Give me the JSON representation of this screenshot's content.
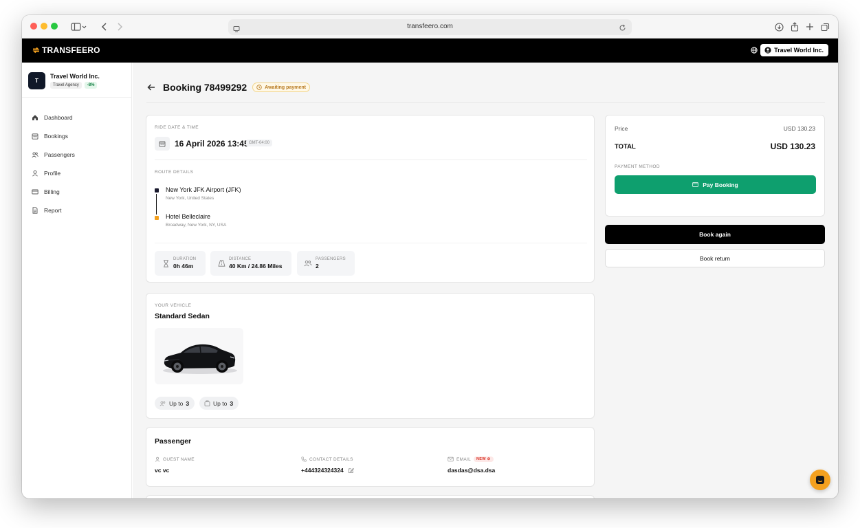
{
  "browser": {
    "url": "transfeero.com",
    "icons": [
      "close-dot",
      "minimize-dot",
      "maximize-dot",
      "sidebar-icon",
      "back-icon",
      "forward-icon",
      "page-icon",
      "reload-icon",
      "download-icon",
      "share-icon",
      "new-tab-icon",
      "tabs-icon"
    ],
    "colors": {
      "close": "#fe5f57",
      "minimize": "#febc2e",
      "maximize": "#28c840"
    }
  },
  "appbar": {
    "brand": "TRANSFEERO",
    "brand_accent": "#f4a11f",
    "language": "EN",
    "account": "Travel World Inc."
  },
  "sidebar": {
    "org_initial": "T",
    "org_name": "Travel World Inc.",
    "org_type": "Travel Agency",
    "discount": "-8%",
    "items": [
      {
        "label": "Dashboard",
        "icon": "home-icon"
      },
      {
        "label": "Bookings",
        "icon": "calendar-icon"
      },
      {
        "label": "Passengers",
        "icon": "users-icon"
      },
      {
        "label": "Profile",
        "icon": "user-icon"
      },
      {
        "label": "Billing",
        "icon": "card-icon"
      },
      {
        "label": "Report",
        "icon": "document-icon"
      }
    ]
  },
  "booking": {
    "title": "Booking 78499292",
    "status": "Awaiting payment",
    "status_color": "#b7791f"
  },
  "ride": {
    "date_label": "RIDE DATE & TIME",
    "datetime": "16 April 2026 13:45",
    "timezone": "GMT-04:00",
    "route_label": "ROUTE DETAILS",
    "pickup_name": "New York JFK Airport (JFK)",
    "pickup_address": "New York, United States",
    "dropoff_name": "Hotel Belleclaire",
    "dropoff_address": "Broadway, New York, NY, USA",
    "stats": {
      "duration_label": "DURATION",
      "duration": "0h 46m",
      "distance_label": "DISTANCE",
      "distance": "40 Km / 24.86 Miles",
      "passengers_label": "PASSENGERS",
      "passengers": "2"
    }
  },
  "vehicle": {
    "label": "YOUR VEHICLE",
    "name": "Standard Sedan",
    "up_to": "Up to",
    "passenger_capacity": "3",
    "luggage_capacity": "3"
  },
  "passenger": {
    "title": "Passenger",
    "guest_label": "GUEST NAME",
    "guest_name": "vc vc",
    "contact_label": "CONTACT DETAILS",
    "contact": "+444324324324",
    "email_label": "EMAIL",
    "email_badge": "NEW",
    "email": "dasdas@dsa.dsa"
  },
  "payment": {
    "price_label": "Price",
    "price": "USD 130.23",
    "total_label": "TOTAL",
    "total": "USD 130.23",
    "method_label": "PAYMENT METHOD",
    "pay_button": "Pay Booking",
    "pay_color": "#0e9f6e",
    "book_again": "Book again",
    "book_return": "Book return"
  }
}
